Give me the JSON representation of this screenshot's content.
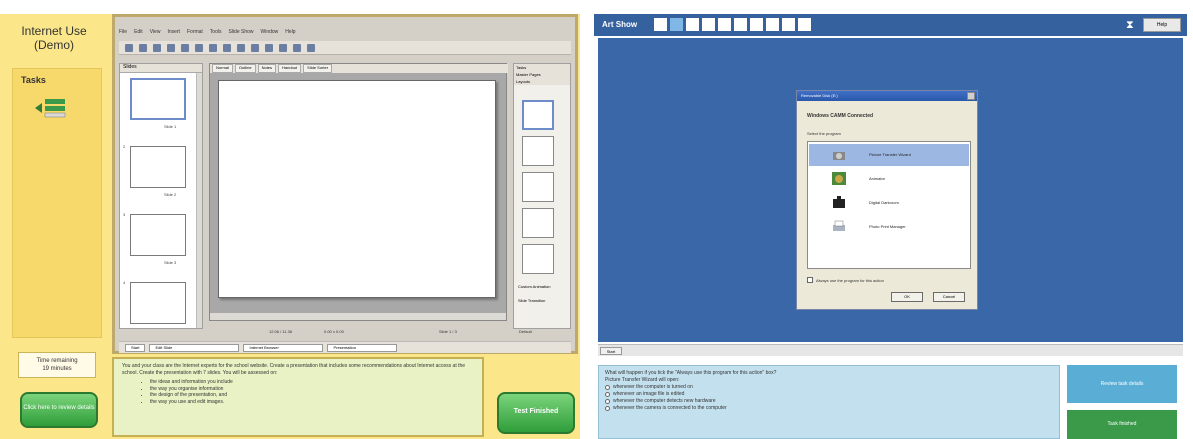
{
  "left": {
    "app_title": "Internet Use (Demo)",
    "tasks_label": "Tasks",
    "time_remaining": {
      "label": "Time remaining",
      "value": "19 minutes"
    },
    "return_button": "Click here to review details",
    "finish_button": "Test Finished",
    "menubar": [
      "File",
      "Edit",
      "View",
      "Insert",
      "Format",
      "Tools",
      "Slide Show",
      "Window",
      "Help"
    ],
    "slides_pane_title": "Slides",
    "slides": [
      {
        "num": "1",
        "label": "Slide 1"
      },
      {
        "num": "2",
        "label": "Slide 2"
      },
      {
        "num": "3",
        "label": "Slide 3"
      },
      {
        "num": "4",
        "label": ""
      }
    ],
    "editor_tabs": [
      "Normal",
      "Outline",
      "Notes",
      "Handout",
      "Slide Sorter"
    ],
    "tasks_pane": {
      "title": "Tasks",
      "items": [
        "Master Pages",
        "Layouts"
      ],
      "footer": [
        "Custom Animation",
        "Slide Transition"
      ]
    },
    "statusbar": {
      "pos": "12.06 / 11.36",
      "size": "0.00 x 0.00",
      "slide": "Slide 1 / 3",
      "layout": "Default"
    },
    "drawbar": {
      "start": "Start",
      "field1": "Edit Slide",
      "field2": "Internet Browser",
      "field3": "Presentation"
    },
    "instructions": {
      "text": "You and your class are the Internet experts for the school website. Create a presentation that includes some recommendations about Internet access at the school. Create the presentation with 7 slides. You will be assessed on:",
      "bullets": [
        "the ideas and information you include",
        "the way you organise information",
        "the design of the presentation, and",
        "the way you use and edit images."
      ]
    }
  },
  "right": {
    "title": "Art Show",
    "progress_total": 10,
    "progress_current": 2,
    "help_label": "Help",
    "dialog": {
      "title": "Removable Disk (E:)",
      "heading": "Windows CAMM Connected",
      "subheading": "Select the program",
      "items": [
        "Picture Transfer Wizard",
        "Animator",
        "Digital Darkroom",
        "Photo Print Manager"
      ],
      "selected_index": 0,
      "checkbox": "Always use the program for this action",
      "ok": "OK",
      "cancel": "Cancel"
    },
    "start_label": "Start",
    "question": {
      "text": "What will happen if you tick the \"Always use this program for this action\" box?",
      "line2": "Picture Transfer Wizard will open:",
      "options": [
        "whenever the computer is turned on",
        "whenever an image file is edited",
        "whenever the computer detects new hardware",
        "whenever the camera is connected to the computer"
      ]
    },
    "review_button": "Review task details",
    "finish_button": "Task finished",
    "colors": {
      "header": "#36619f",
      "desktop": "#3a67a8",
      "question_bg": "#c3e0ee",
      "review": "#5aaed6",
      "finish": "#3a9a4a"
    }
  }
}
